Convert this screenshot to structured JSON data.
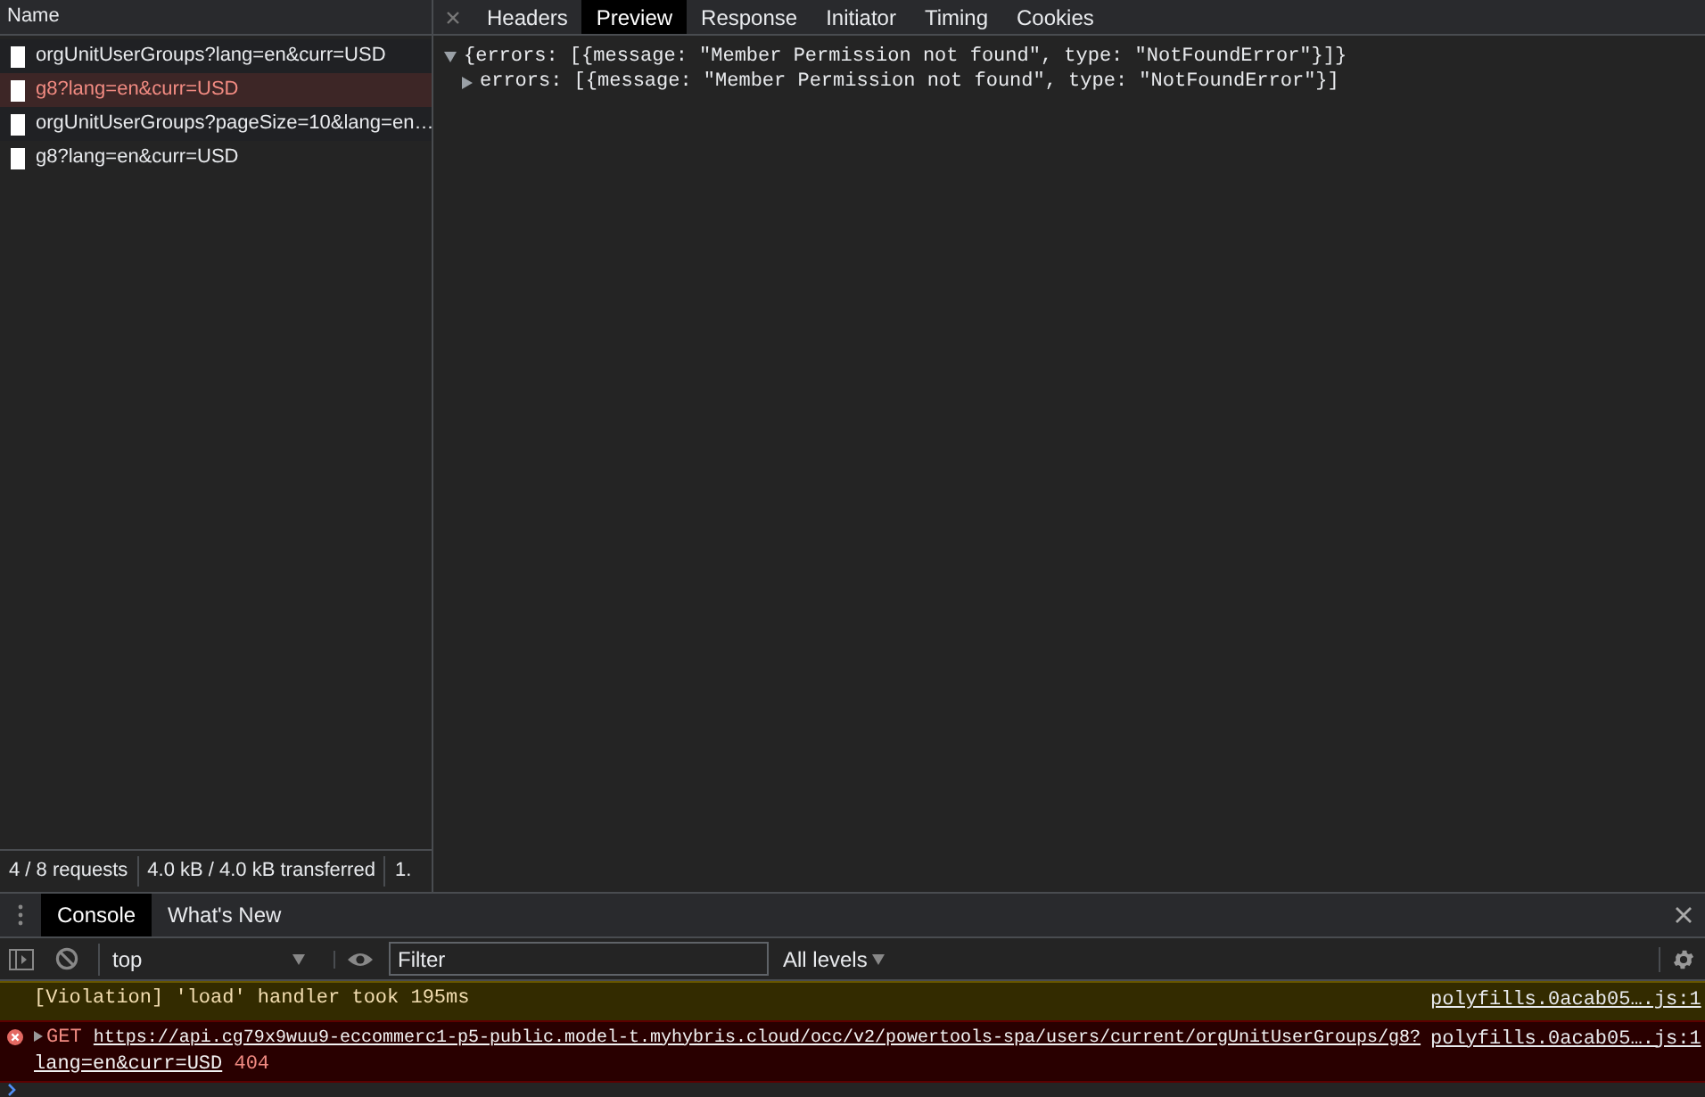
{
  "requests_panel": {
    "column_header": "Name",
    "requests": [
      {
        "name": "orgUnitUserGroups?lang=en&curr=USD",
        "selected": false
      },
      {
        "name": "g8?lang=en&curr=USD",
        "selected": true
      },
      {
        "name": "orgUnitUserGroups?pageSize=10&lang=en…",
        "selected": false
      },
      {
        "name": "g8?lang=en&curr=USD",
        "selected": false
      }
    ],
    "status_bar": [
      "4 / 8 requests",
      "4.0 kB / 4.0 kB transferred",
      "1."
    ]
  },
  "detail_tabs": [
    {
      "label": "Headers",
      "selected": false
    },
    {
      "label": "Preview",
      "selected": true
    },
    {
      "label": "Response",
      "selected": false
    },
    {
      "label": "Initiator",
      "selected": false
    },
    {
      "label": "Timing",
      "selected": false
    },
    {
      "label": "Cookies",
      "selected": false
    }
  ],
  "preview": [
    {
      "text": "{errors: [{message: \"Member Permission not found\", type: \"NotFoundError\"}]}",
      "expanded": true,
      "children": [
        {
          "text": "errors: [{message: \"Member Permission not found\", type: \"NotFoundError\"}]",
          "expanded": false
        }
      ]
    }
  ],
  "drawer_tabs": [
    {
      "label": "Console",
      "selected": true
    },
    {
      "label": "What's New",
      "selected": false
    }
  ],
  "console_toolbar": {
    "context": "top",
    "filter": {
      "placeholder": "Filter"
    },
    "levels": "All levels"
  },
  "messages": [
    {
      "kind": "warning",
      "text": "[Violation] 'load' handler took 195ms",
      "source": "polyfills.0acab05….js:1"
    },
    {
      "kind": "error",
      "method": "GET",
      "url_lines": [
        "https://api.cg79x9wuu9-eccommerc1-p5-public.model-t.myhybris.cloud/occ/v2/powertools-spa/users/current/orgUnitUserGroups/g8?",
        "lang=en&curr=USD"
      ],
      "status": "404",
      "source": "polyfills.0acab05….js:1"
    }
  ]
}
